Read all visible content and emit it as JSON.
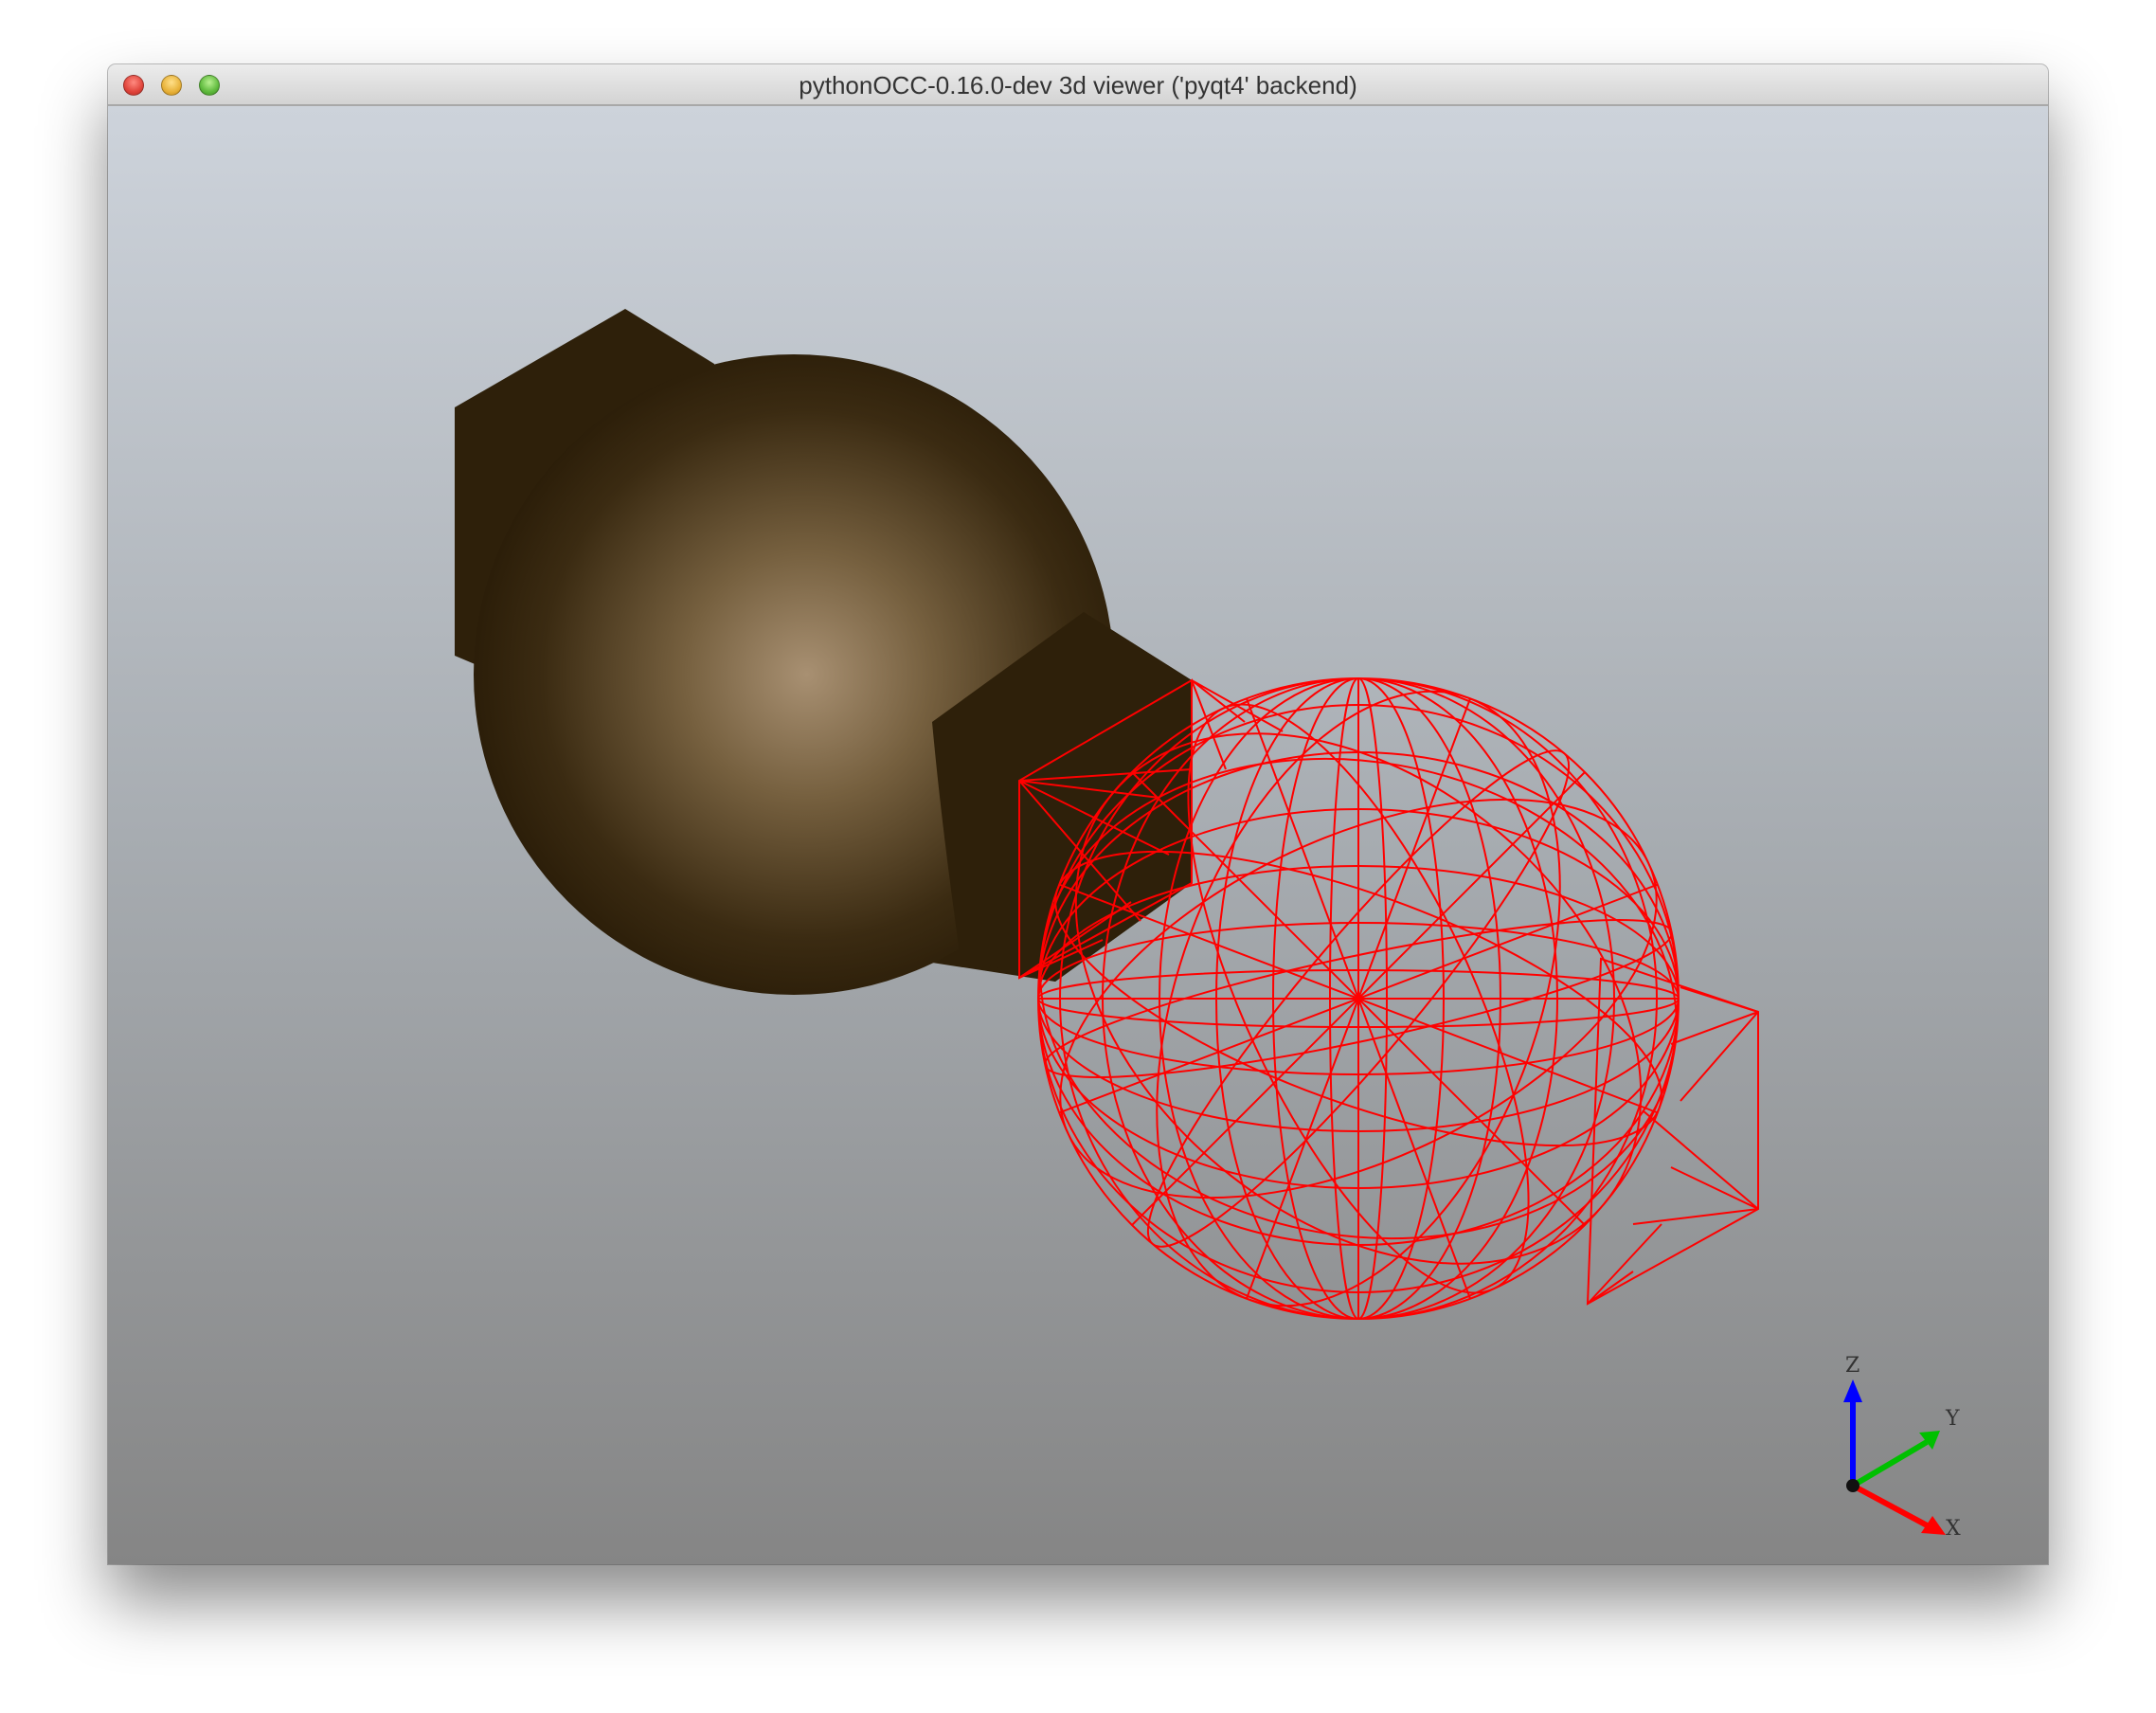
{
  "window": {
    "title": "pythonOCC-0.16.0-dev 3d viewer ('pyqt4' backend)"
  },
  "viewport": {
    "background_top": "#cdd3db",
    "background_bottom": "#858585",
    "solid_color": "#2e200a",
    "solid_highlight": "#a89072",
    "wireframe_color": "#ff0000"
  },
  "trihedron": {
    "z_label": "Z",
    "y_label": "Y",
    "x_label": "X",
    "z_color": "#0000ff",
    "y_color": "#00c000",
    "x_color": "#ff0000"
  }
}
